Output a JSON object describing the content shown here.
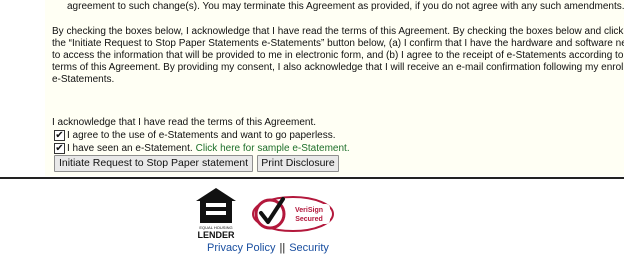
{
  "agreement": {
    "top_line": "agreement to such change(s). You may terminate this Agreement as provided, if you do not agree with any such amendments.",
    "consent_lines": [
      "By checking the boxes below, I acknowledge that I have read the terms of this Agreement. By checking the boxes below and clicking or",
      "the “Initiate Request to Stop Paper Statements e-Statements” button below, (a) I confirm that I have the hardware and software necess",
      "to access the information that will be provided to me in electronic form, and (b) I agree to the receipt of e-Statements according to the",
      "terms of this Agreement. By providing my consent, I also acknowledge that I will receive an e-mail confirmation following my enrollment",
      "e-Statements."
    ],
    "acknowledge_text": "I acknowledge that I have read the terms of this Agreement."
  },
  "checkboxes": [
    {
      "label": "I agree to the use of e-Statements and want to go paperless.",
      "checked": true,
      "link_text": ""
    },
    {
      "label": "I have seen an e-Statement.",
      "checked": true,
      "link_text": "Click here for sample e-Statement."
    }
  ],
  "buttons": {
    "initiate_label": "Initiate Request to Stop Paper statement",
    "print_label": "Print Disclosure"
  },
  "footer": {
    "ehl_text": "EQUAL HOUSING LENDER",
    "verisign_text": "VeriSign Secured",
    "privacy_link": "Privacy Policy",
    "separator": "||",
    "security_link": "Security"
  },
  "icons": {
    "checkmark": "check-icon",
    "ehl": "equal-housing-lender-icon",
    "verisign": "verisign-secured-icon"
  },
  "colors": {
    "panel_bg": "#fffff4",
    "link_green": "#1e6f2a",
    "link_blue": "#1a4fa0",
    "verisign_red": "#b3183c"
  }
}
